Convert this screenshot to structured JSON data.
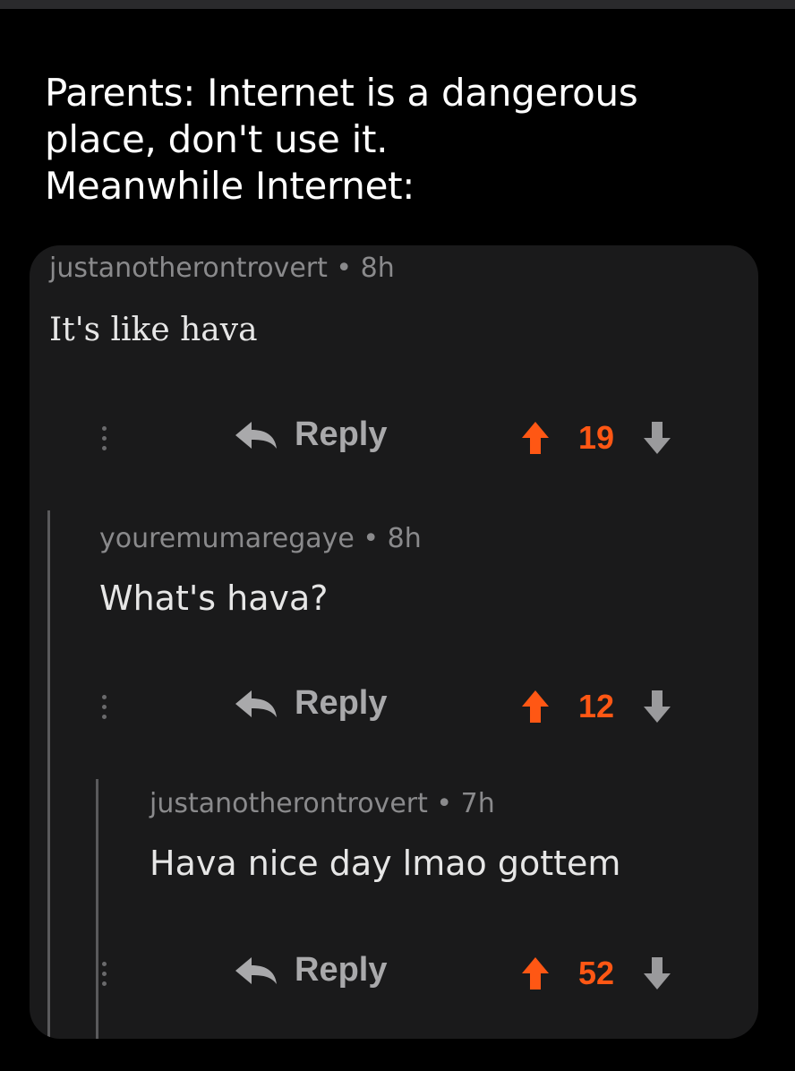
{
  "caption": "Parents: Internet is a dangerous\nplace, don't use it.\nMeanwhile Internet:",
  "colors": {
    "upvote": "#ff5714",
    "downvote": "#9a9a9c",
    "card_bg": "#1a1a1b",
    "page_bg": "#000000"
  },
  "comments": [
    {
      "author_meta": "justanotherontrovert • 8h",
      "text": "It's like hava",
      "reply_label": "Reply",
      "score": "19",
      "icons": [
        "more-icon",
        "reply-arrow-icon",
        "upvote-arrow-icon",
        "downvote-arrow-icon"
      ]
    },
    {
      "author_meta": "youremumaregaye • 8h",
      "text": "What's hava?",
      "reply_label": "Reply",
      "score": "12"
    },
    {
      "author_meta": "justanotherontrovert • 7h",
      "text": "Hava nice day lmao gottem",
      "reply_label": "Reply",
      "score": "52"
    }
  ]
}
